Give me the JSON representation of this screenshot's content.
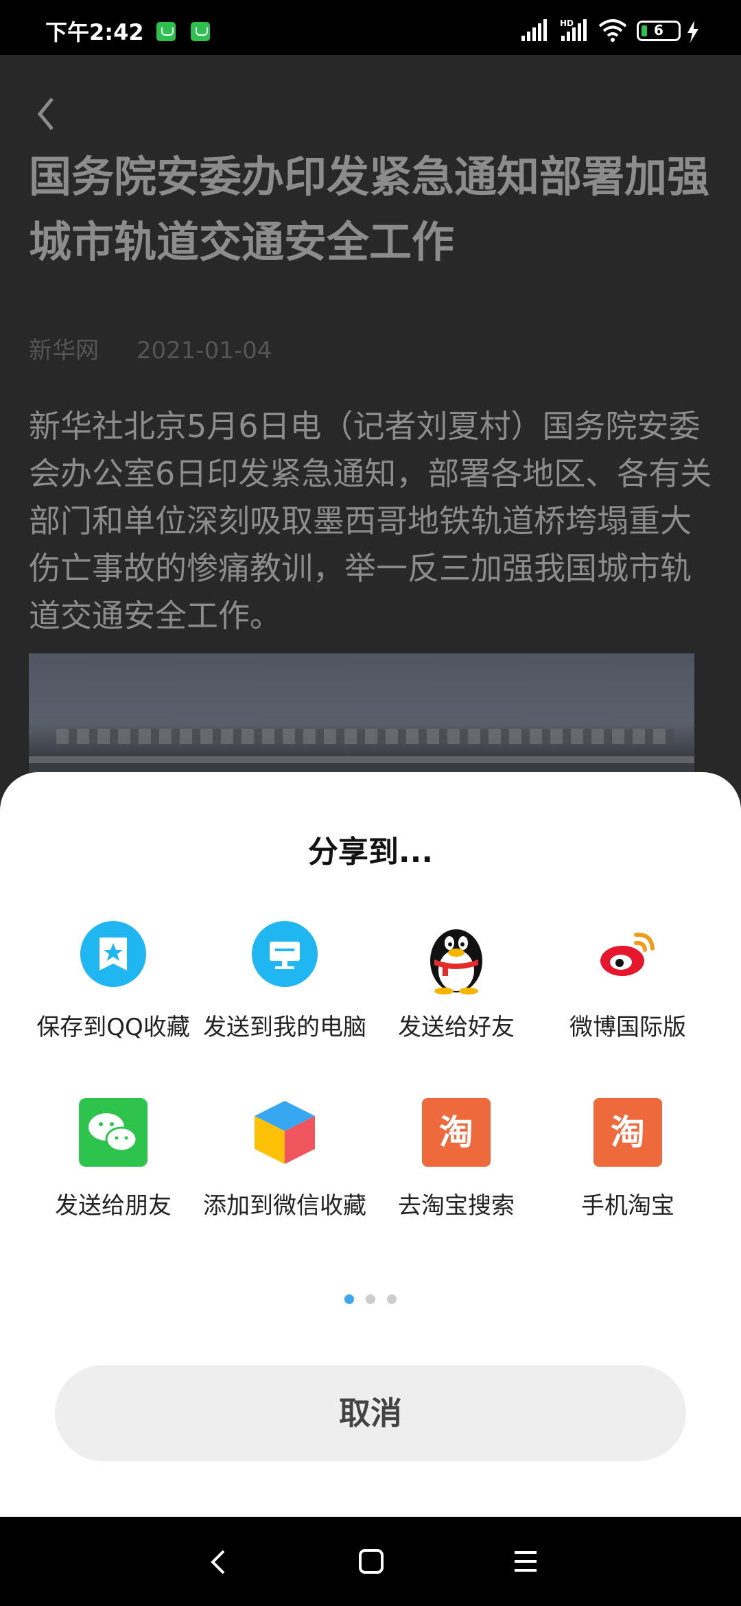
{
  "status_bar": {
    "time": "下午2:42",
    "battery_level": "6"
  },
  "article": {
    "title": "国务院安委办印发紧急通知部署加强城市轨道交通安全工作",
    "source": "新华网",
    "date": "2021-01-04",
    "body": "新华社北京5月6日电（记者刘夏村）国务院安委会办公室6日印发紧急通知，部署各地区、各有关部门和单位深刻吸取墨西哥地铁轨道桥垮塌重大伤亡事故的惨痛教训，举一反三加强我国城市轨道交通安全工作。"
  },
  "share_sheet": {
    "title": "分享到...",
    "items": [
      {
        "label": "保存到QQ收藏",
        "icon": "qq-favorites-icon"
      },
      {
        "label": "发送到我的电脑",
        "icon": "my-computer-icon"
      },
      {
        "label": "发送给好友",
        "icon": "qq-penguin-icon"
      },
      {
        "label": "微博国际版",
        "icon": "weibo-icon"
      },
      {
        "label": "发送给朋友",
        "icon": "wechat-icon"
      },
      {
        "label": "添加到微信收藏",
        "icon": "wechat-favorites-cube-icon"
      },
      {
        "label": "去淘宝搜索",
        "icon": "taobao-icon",
        "glyph": "淘"
      },
      {
        "label": "手机淘宝",
        "icon": "taobao-icon",
        "glyph": "淘"
      }
    ],
    "page_count": 3,
    "current_page": 1,
    "cancel_label": "取消"
  },
  "colors": {
    "accent_blue": "#1fb6f2",
    "wechat_green": "#2dc34d",
    "taobao_orange": "#ee6a3c",
    "weibo_red": "#e6162d",
    "page_dot_active": "#3fa7f0"
  }
}
